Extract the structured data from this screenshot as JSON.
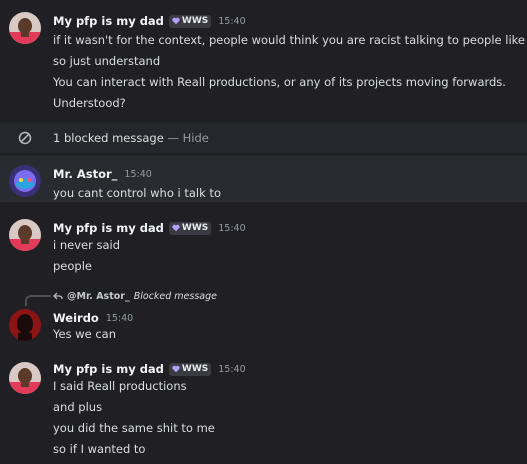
{
  "messages": [
    {
      "author": "My pfp is my dad",
      "tag": "WWS",
      "time": "15:40",
      "lines": [
        "if it wasn't for the context, people would think you are racist talking to people like this.",
        "so just understand",
        "You can interact with Reall productions, or any of its projects moving forwards.",
        "Understood?"
      ]
    },
    {
      "author": "Mr. Astor_",
      "time": "15:40",
      "lines": [
        "you cant control who i talk to"
      ]
    },
    {
      "author": "My pfp is my dad",
      "tag": "WWS",
      "time": "15:40",
      "lines": [
        "i never said",
        "people"
      ]
    },
    {
      "author": "Weirdo",
      "time": "15:40",
      "lines": [
        "Yes we can"
      ],
      "reply": {
        "mention": "@Mr. Astor_",
        "text": "Blocked message"
      }
    },
    {
      "author": "My pfp is my dad",
      "tag": "WWS",
      "time": "15:40",
      "lines": [
        "I said Reall productions",
        "and plus",
        "you did the same shit to me",
        "so if I wanted to"
      ]
    }
  ],
  "blocked": {
    "count_text": "1 blocked message",
    "separator": "—",
    "hide_label": "Hide"
  },
  "colors": {
    "background": "#1f1f24",
    "username": "#f2f3f5",
    "timestamp": "#949ba4",
    "blocked_bar": "#26272c"
  },
  "icons": {
    "blocked": "blocked-circle-icon",
    "reply": "reply-arrow-icon",
    "tag": "heart-badge-icon"
  }
}
